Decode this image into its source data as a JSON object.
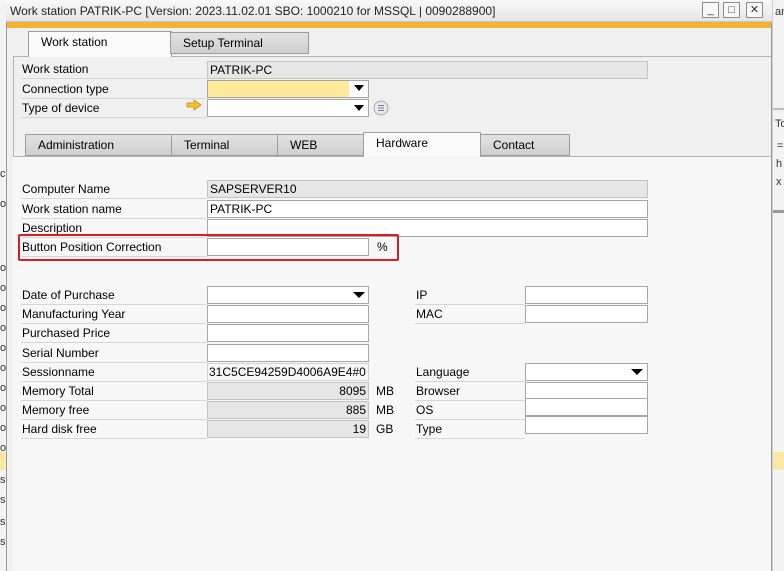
{
  "window": {
    "title": "Work station PATRIK-PC [Version: 2023.11.02.01 SBO: 1000210 for MSSQL | 0090288900]",
    "minimize_glyph": "_",
    "maximize_glyph": "□",
    "close_glyph": "✕"
  },
  "background": {
    "right_chars": [
      "an",
      "To",
      "=",
      "h",
      "x"
    ],
    "left_chars": [
      "o",
      "o",
      "c",
      "o",
      "o",
      "o",
      "o",
      "o",
      "o",
      "o",
      "o",
      "o",
      "o",
      "o",
      "o",
      "o",
      "s",
      "s",
      "s",
      "s"
    ]
  },
  "top_tabs": [
    {
      "label": "Work station",
      "active": true
    },
    {
      "label": "Setup Terminal",
      "active": false
    }
  ],
  "header_fields": {
    "workstation_label": "Work station",
    "workstation_value": "PATRIK-PC",
    "connection_type_label": "Connection type",
    "connection_type_value": "",
    "device_type_label": "Type of device",
    "device_type_value": ""
  },
  "sub_tabs": [
    {
      "label": "Administration",
      "active": false
    },
    {
      "label": "Terminal",
      "active": false
    },
    {
      "label": "WEB",
      "active": false
    },
    {
      "label": "Hardware",
      "active": true
    },
    {
      "label": "Contact",
      "active": false
    }
  ],
  "hardware": {
    "computer_name_label": "Computer Name",
    "computer_name_value": "SAPSERVER10",
    "ws_name_label": "Work station name",
    "ws_name_value": "PATRIK-PC",
    "description_label": "Description",
    "description_value": "",
    "button_pos_label": "Button Position Correction",
    "button_pos_value": "",
    "button_pos_unit": "%",
    "date_of_purchase_label": "Date of Purchase",
    "manufacturing_year_label": "Manufacturing Year",
    "purchased_price_label": "Purchased Price",
    "serial_number_label": "Serial Number",
    "sessionname_label": "Sessionname",
    "sessionname_value": "31C5CE94259D4006A9E4#0",
    "memory_total_label": "Memory Total",
    "memory_total_value": "8095",
    "memory_total_unit": "MB",
    "memory_free_label": "Memory free",
    "memory_free_value": "885",
    "memory_free_unit": "MB",
    "hdd_free_label": "Hard disk free",
    "hdd_free_value": "19",
    "hdd_free_unit": "GB",
    "ip_label": "IP",
    "mac_label": "MAC",
    "language_label": "Language",
    "browser_label": "Browser",
    "os_label": "OS",
    "type_label": "Type"
  },
  "colors": {
    "accent": "#f2b233",
    "highlight_yellow": "#fdeb9b",
    "annotation_red": "#d81e1e",
    "arrow_yellow": "#f4c430"
  }
}
